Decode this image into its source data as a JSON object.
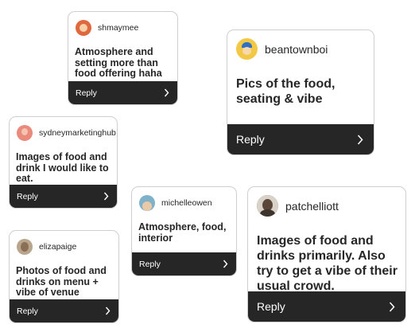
{
  "cards": [
    {
      "username": "shmaymee",
      "message": "Atmosphere and setting more than food offering haha",
      "reply_label": "Reply",
      "avatar_color": "#e0683e"
    },
    {
      "username": "beantownboi",
      "message": "Pics of the food, seating & vibe",
      "reply_label": "Reply",
      "avatar_color": "#f2c844"
    },
    {
      "username": "sydneymarketinghub",
      "message": "Images of food and drink I would like to eat.",
      "reply_label": "Reply",
      "avatar_color": "#e98a7c"
    },
    {
      "username": "michelleowen",
      "message": "Atmosphere, food, interior",
      "reply_label": "Reply",
      "avatar_color": "#7fb2c9"
    },
    {
      "username": "elizapaige",
      "message": "Photos of food and drinks on menu + vibe of venue",
      "reply_label": "Reply",
      "avatar_color": "#b9a58d"
    },
    {
      "username": "patchelliott",
      "message": "Images of food and drinks primarily. Also try to get a vibe of their usual crowd.",
      "reply_label": "Reply",
      "avatar_color": "#6f5a4c"
    }
  ],
  "colors": {
    "reply_bar": "#262626",
    "text": "#262626",
    "border": "#cfcfcf"
  }
}
